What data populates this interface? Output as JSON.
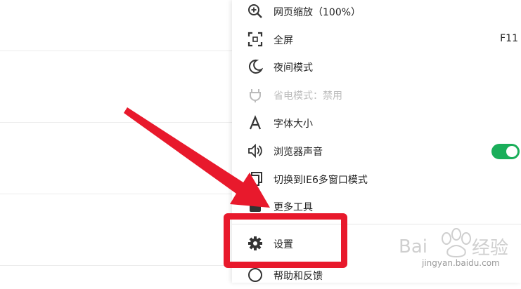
{
  "menu": {
    "items": [
      {
        "label": "网页缩放（100%）",
        "icon": "zoom-icon"
      },
      {
        "label": "全屏",
        "icon": "fullscreen-icon",
        "shortcut": "F11"
      },
      {
        "label": "夜间模式",
        "icon": "moon-icon"
      },
      {
        "label": "省电模式：禁用",
        "icon": "plug-icon",
        "disabled": true
      },
      {
        "label": "字体大小",
        "icon": "font-icon"
      },
      {
        "label": "浏览器声音",
        "icon": "speaker-icon",
        "toggle_on": true
      },
      {
        "label": "切换到IE6多窗口模式",
        "icon": "window-icon"
      },
      {
        "label": "更多工具",
        "icon": "toolbox-icon"
      },
      {
        "label": "设置",
        "icon": "gear-icon"
      },
      {
        "label": "帮助和反馈",
        "icon": "help-icon"
      }
    ]
  },
  "colors": {
    "accent_red": "#e8192c",
    "toggle_green": "#1aae5a"
  },
  "watermark": {
    "text": "jingyan.baidu.com",
    "brand": "Bai 经验"
  }
}
